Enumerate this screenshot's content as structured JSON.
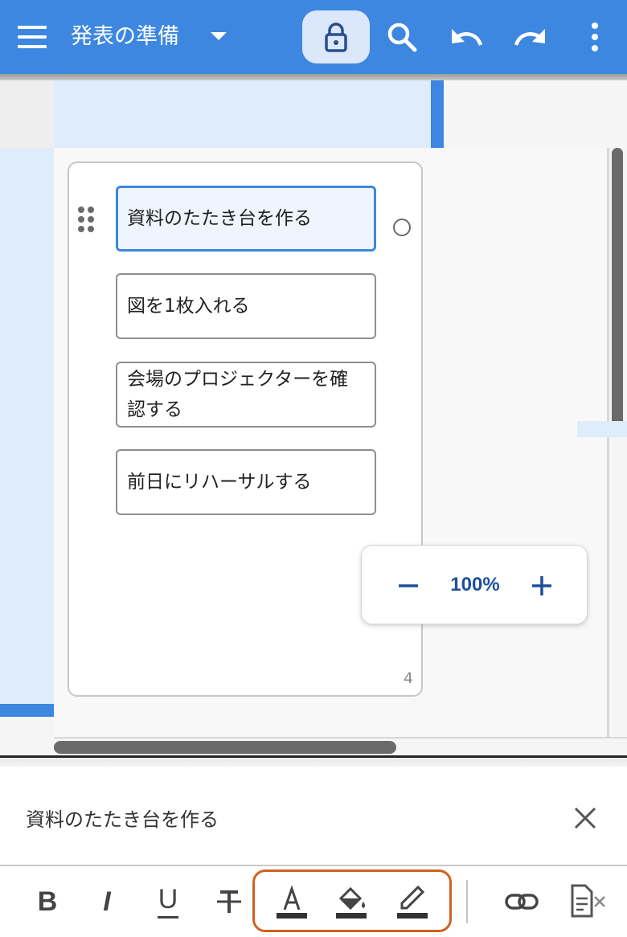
{
  "header": {
    "title": "発表の準備",
    "colors": {
      "bar": "#3d87e0",
      "lock_bg": "#dbe7fb"
    },
    "icons": [
      "menu-icon",
      "dropdown-caret-icon",
      "lock-icon",
      "search-icon",
      "undo-icon",
      "redo-icon",
      "more-vert-icon"
    ]
  },
  "canvas": {
    "items": [
      {
        "text": "資料のたたき台を作る",
        "selected": true
      },
      {
        "text": "図を1枚入れる",
        "selected": false
      },
      {
        "text": "会場のプロジェクターを確認する",
        "selected": false
      },
      {
        "text": "前日にリハーサルする",
        "selected": false
      }
    ],
    "page_number": "4",
    "zoom": {
      "level": "100%"
    }
  },
  "editor": {
    "text": "資料のたたき台を作る",
    "toolbar": {
      "bold": "B",
      "italic": "I",
      "underline": "U",
      "icons": [
        "bold-icon",
        "italic-icon",
        "underline-icon",
        "strikethrough-icon",
        "text-color-icon",
        "fill-color-icon",
        "border-color-icon",
        "link-icon",
        "clear-format-icon"
      ],
      "highlight_color": "#d0621f"
    }
  }
}
